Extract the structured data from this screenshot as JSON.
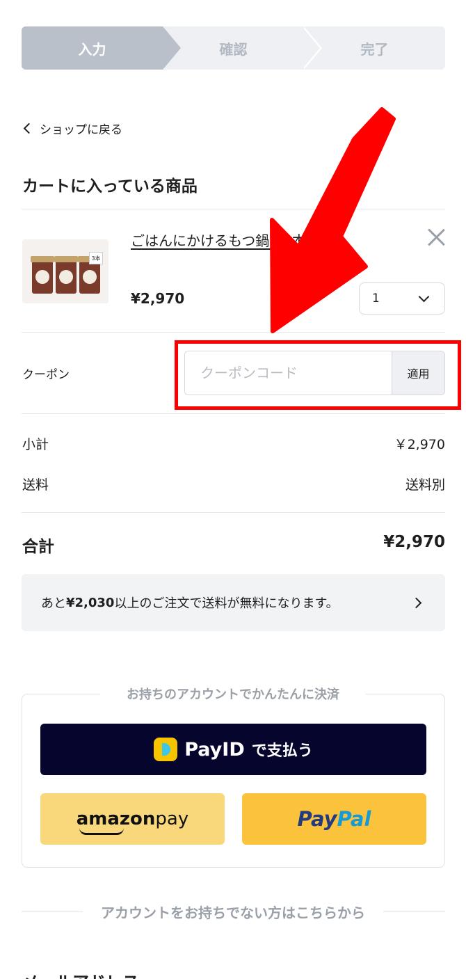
{
  "steps": [
    {
      "label": "入力",
      "active": true
    },
    {
      "label": "確認",
      "active": false
    },
    {
      "label": "完了",
      "active": false
    }
  ],
  "back_link": "ショップに戻る",
  "cart_title": "カートに入っている商品",
  "product": {
    "name": "ごはんにかけるもつ鍋　3本セット",
    "price": "¥2,970",
    "quantity": "1",
    "image_badge": "3本"
  },
  "coupon": {
    "label": "クーポン",
    "placeholder": "クーポンコード",
    "apply_label": "適用"
  },
  "summary": {
    "subtotal_label": "小計",
    "subtotal_value": "￥2,970",
    "shipping_label": "送料",
    "shipping_value": "送料別",
    "total_label": "合計",
    "total_value": "¥2,970"
  },
  "free_shipping_notice": {
    "prefix": "あと",
    "amount": "¥2,030",
    "suffix": "以上のご注文で送料が無料になります。"
  },
  "account_payment": {
    "title": "お持ちのアカウントでかんたんに決済",
    "payid_word": "PayID",
    "payid_suffix": "で支払う",
    "amazon_word": "amazon",
    "amazon_suffix": " pay",
    "paypal_part1": "Pay",
    "paypal_part2": "Pal"
  },
  "no_account_text": "アカウントをお持ちでない方はこちらから",
  "next_heading": "メールアドレス",
  "colors": {
    "annotation": "#ff0000",
    "payid_bg": "#05052e",
    "amazon_bg": "#f8d87a",
    "paypal_bg": "#fbc33c"
  }
}
